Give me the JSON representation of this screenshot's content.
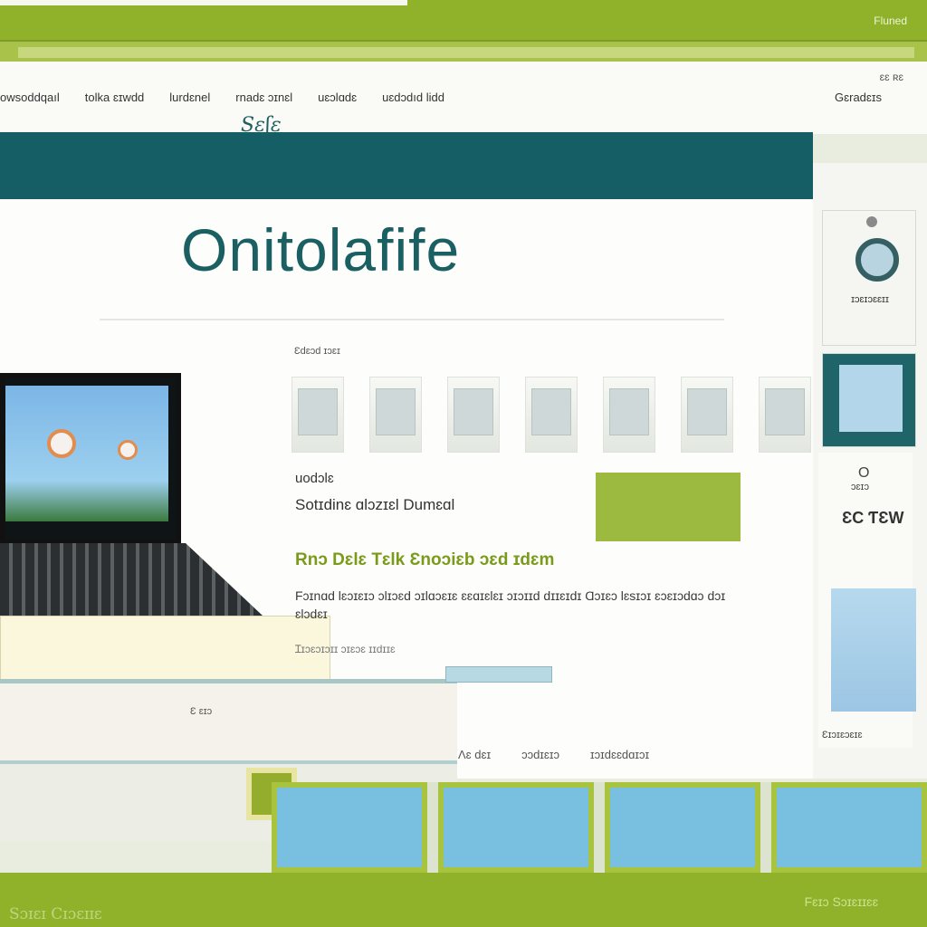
{
  "window": {
    "corner_label": "Fluned"
  },
  "nav": {
    "tiny_label": "ɛɛ ʀɛ",
    "menu": [
      "owsoddqaıl",
      "tolka ɛɪwdd",
      "lurdɛnel",
      "rnadɛ ɔɪnɛl",
      "uɛɔlɑdɛ",
      "uɛdɔdıd lidd"
    ],
    "right_link": "Gɛradɛɪs"
  },
  "header": {
    "small_logo": "Sɛʃɛ",
    "brand": "Onitolafife"
  },
  "main": {
    "thumbs_label": "Ɛdɛɔd ɪɔɛɪ",
    "section_title": "uodɔlɛ",
    "section_sub": "Sotɪdinɛ ɑlɔzɪɛl Dumɛɑl",
    "headline": "Rnɔ Dɛlɛ Tɛlk Ɛnoɔiɛb ɔɛd ɪdɛm",
    "paragraph": "Fɔɪnɑd lɛɔɪɛɪɔ ɔlɪɔɛd ɔɪlɑɔɛɪɛ ɛɛɑɪɛlɛɪ ɔɪɔɪɪd dɪɪɛɪdɪ Ɑɔɪɛɔ lɛsɪɔɪ ɛɔɛɪɔdɑɔ dɔɪ ɛlɔdɛɪ",
    "paragraph2": "Ɪɪɔɛɔɪɔɪɪ ɔɪɛɔɛ ɪɪdɪɪɛ",
    "book_label": "Ɛ ɛɪɔ",
    "footer_links": [
      "Ʌɛ dɛɪ",
      "ɔɔdɪɛɪɔ",
      "ɪɔɪdɛɛdɑɪɔɪ"
    ]
  },
  "sidebar": {
    "card1_caption": "ɪɔɛɪɔɛɛɪɪ",
    "card3_o": "O",
    "card3_small": "ɔɛɪɔ",
    "card3_label": "ƐC ƬƐW",
    "card3_note": "Ɛɪɔɪɛɔɛɪɛ"
  },
  "footer": {
    "left": "Sɔɪɛɪ Cɪɔɛɪɪɛ",
    "right": "Fɛɪɔ Sɔɪɛɪɪɛɛ"
  },
  "colors": {
    "accent_green": "#8fb22a",
    "teal": "#155e66",
    "button_green": "#9bba3f"
  }
}
